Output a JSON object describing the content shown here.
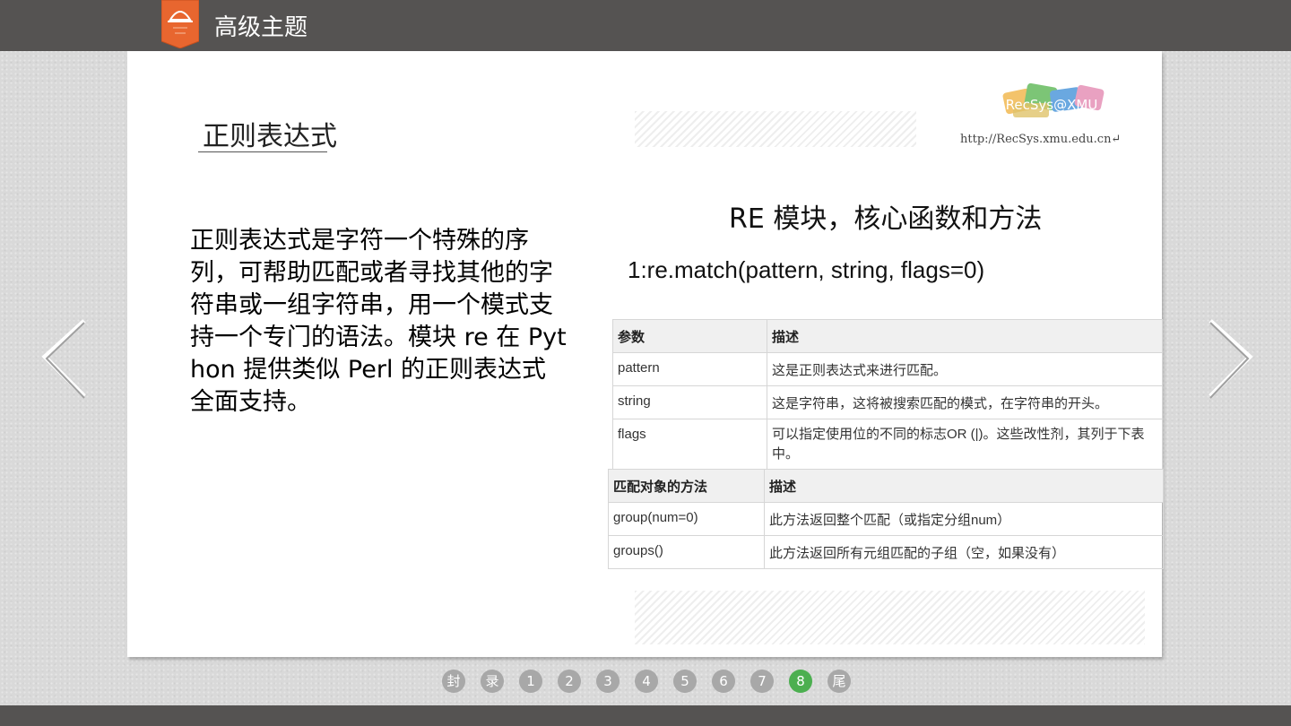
{
  "header": {
    "title": "高级主题"
  },
  "slide": {
    "section_title": "正则表达式",
    "paragraph": "正则表达式是字符一个特殊的序列，可帮助匹配或者寻找其他的字符串或一组字符串，用一个模式支持一个专门的语法。模块 re 在 Python 提供类似 Perl 的正则表达式全面支持。",
    "logo_text": "RecSys@XMU",
    "logo_url": "http://RecSys.xmu.edu.cn↵",
    "re_title": "RE 模块，核心函数和方法",
    "re_function": "1:re.match(pattern, string, flags=0)",
    "params_table": {
      "headers": [
        "参数",
        "描述"
      ],
      "rows": [
        [
          "pattern",
          "这是正则表达式来进行匹配。"
        ],
        [
          "string",
          "这是字符串，这将被搜索匹配的模式，在字符串的开头。"
        ],
        [
          "flags",
          "可以指定使用位的不同的标志OR (|)。这些改性剂，其列于下表中。"
        ]
      ]
    },
    "methods_table": {
      "headers": [
        "匹配对象的方法",
        "描述"
      ],
      "rows": [
        [
          "group(num=0)",
          "此方法返回整个匹配（或指定分组num）"
        ],
        [
          "groups()",
          "此方法返回所有元组匹配的子组（空，如果没有）"
        ]
      ]
    }
  },
  "pager": {
    "items": [
      "封",
      "录",
      "1",
      "2",
      "3",
      "4",
      "5",
      "6",
      "7",
      "8",
      "尾"
    ],
    "active_index": 9
  },
  "colors": {
    "topbar": "#555352",
    "badge": "#e8662f",
    "active_dot": "#4caf50",
    "inactive_dot": "#a8a8a8"
  }
}
